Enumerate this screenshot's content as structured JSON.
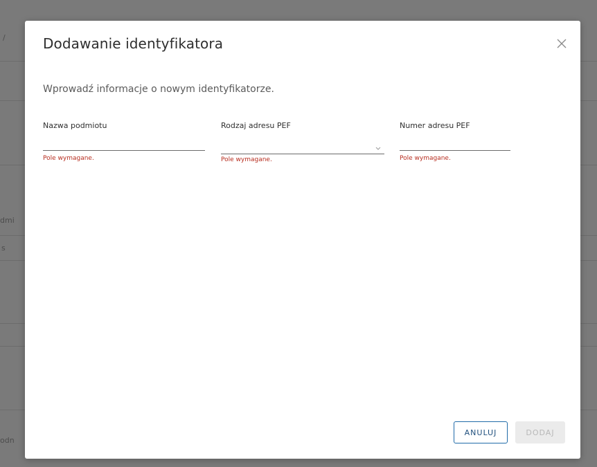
{
  "background": {
    "fragments": [
      "/",
      "dmi",
      "s",
      "odn"
    ]
  },
  "modal": {
    "title": "Dodawanie identyfikatora",
    "description": "Wprowadź informacje o nowym identyfikatorze.",
    "close_icon": "close-icon",
    "fields": [
      {
        "label": "Nazwa podmiotu",
        "value": "",
        "error": "Pole wymagane."
      },
      {
        "label": "Rodzaj adresu PEF",
        "value": "",
        "error": "Pole wymagane.",
        "icon": "chevron-down-icon"
      },
      {
        "label": "Numer adresu PEF",
        "value": "",
        "error": "Pole wymagane."
      }
    ],
    "buttons": {
      "cancel_label": "ANULUJ",
      "add_label": "DODAJ"
    }
  },
  "colors": {
    "overlay": "#7a7a7a",
    "error": "#b72d1f",
    "primary": "#1f6aa8",
    "disabled_bg": "#ebebeb",
    "disabled_text": "#b8b8b8"
  }
}
